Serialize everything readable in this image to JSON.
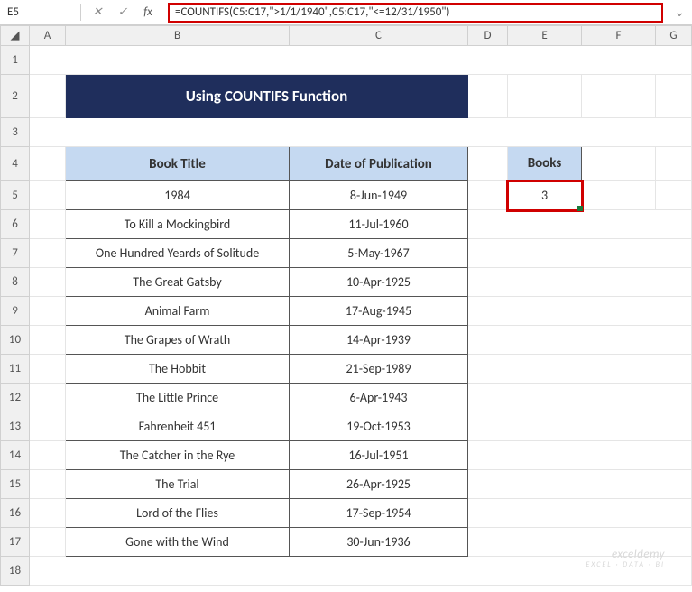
{
  "nameBox": "E5",
  "formula": "=COUNTIFS(C5:C17,\">1/1/1940\",C5:C17,\"<=12/31/1950\")",
  "columns": [
    "A",
    "B",
    "C",
    "D",
    "E",
    "F",
    "G"
  ],
  "title": "Using COUNTIFS Function",
  "headers": {
    "book": "Book Title",
    "date": "Date of Publication",
    "books": "Books"
  },
  "booksValue": "3",
  "rows": [
    {
      "title": "1984",
      "date": "8-Jun-1949"
    },
    {
      "title": "To Kill a Mockingbird",
      "date": "11-Jul-1960"
    },
    {
      "title": "One Hundred Yeards of Solitude",
      "date": "5-May-1967"
    },
    {
      "title": "The Great Gatsby",
      "date": "10-Apr-1925"
    },
    {
      "title": "Animal Farm",
      "date": "17-Aug-1945"
    },
    {
      "title": "The Grapes of Wrath",
      "date": "14-Apr-1939"
    },
    {
      "title": "The Hobbit",
      "date": "21-Sep-1989"
    },
    {
      "title": "The Little Prince",
      "date": "6-Apr-1943"
    },
    {
      "title": "Fahrenheit 451",
      "date": "19-Oct-1953"
    },
    {
      "title": "The Catcher in the Rye",
      "date": "16-Jul-1951"
    },
    {
      "title": "The Trial",
      "date": "26-Apr-1925"
    },
    {
      "title": "Lord of the Flies",
      "date": "17-Sep-1954"
    },
    {
      "title": "Gone with the Wind",
      "date": "30-Jun-1936"
    }
  ],
  "watermark": {
    "brand": "exceldemy",
    "tag": "EXCEL · DATA · BI"
  }
}
